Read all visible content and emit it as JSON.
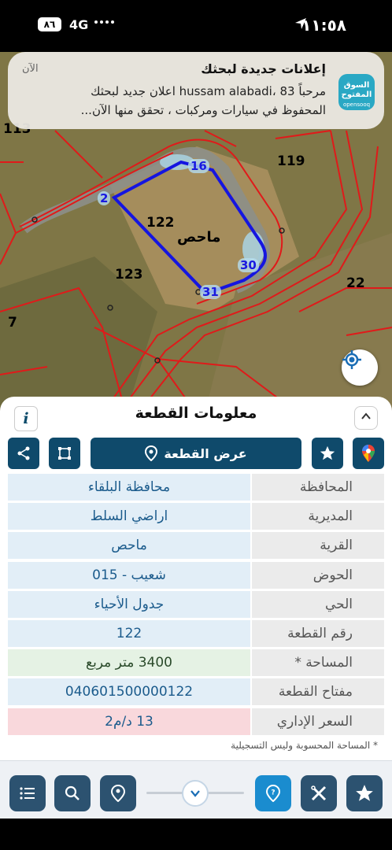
{
  "status_bar": {
    "time": "١١:٥٨",
    "network": "4G",
    "battery": "٨٦"
  },
  "notification": {
    "app_icon_text": "السوق المفتوح",
    "app_icon_sub": "opensooq",
    "title": "إعلانات جديدة لبحثك",
    "time": "الآن",
    "body": "مرحباً hussam alabadi، 83 اعلان جديد لبحثك المحفوظ في سيارات ومركبات ، تحقق منها الآن..."
  },
  "map": {
    "parcel_numbers": [
      "122",
      "123",
      "119",
      "22",
      "7",
      "113"
    ],
    "village_label": "ماحص",
    "vertices": [
      "16",
      "2",
      "30",
      "31"
    ],
    "colors": {
      "parcel_outline": "#1515e0",
      "boundaries": "#e01a1a"
    }
  },
  "panel": {
    "title": "معلومات القطعة",
    "info_icon": "i",
    "show_parcel_label": "عرض القطعة",
    "rows": [
      {
        "key": "المحافظة",
        "value": "محافظة البلقاء",
        "style": "normal"
      },
      {
        "key": "المديرية",
        "value": "اراضي السلط",
        "style": "normal"
      },
      {
        "key": "القرية",
        "value": "ماحص",
        "style": "normal"
      },
      {
        "key": "الحوض",
        "value": "شعيب - 015",
        "style": "normal"
      },
      {
        "key": "الحي",
        "value": "جدول الأحياء",
        "style": "normal"
      },
      {
        "key": "رقم القطعة",
        "value": "122",
        "style": "normal"
      },
      {
        "key": "المساحة *",
        "value": "3400  متر مربع",
        "style": "green"
      },
      {
        "key": "مفتاح القطعة",
        "value": "040601500000122",
        "style": "normal"
      },
      {
        "key": "السعر الإداري",
        "value": "13 د/م2",
        "style": "red"
      }
    ],
    "note": "* المساحة المحسوبة وليس التسجيلية"
  },
  "bottom_bar": {
    "buttons": [
      "list-icon",
      "search-icon",
      "location-pin-icon",
      "help-pin-icon",
      "measure-icon",
      "star-icon"
    ]
  }
}
